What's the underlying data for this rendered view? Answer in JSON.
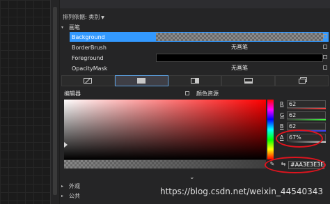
{
  "panel": {
    "sort_label": "排列依据: 类别",
    "section_brush": "画笔",
    "section_appearance": "外观",
    "section_common": "公共"
  },
  "properties": [
    {
      "name": "Background",
      "value": "",
      "kind": "checker",
      "selected": true
    },
    {
      "name": "BorderBrush",
      "value": "无画笔",
      "kind": "text"
    },
    {
      "name": "Foreground",
      "value": "",
      "kind": "black"
    },
    {
      "name": "OpacityMask",
      "value": "无画笔",
      "kind": "text"
    }
  ],
  "brush_tabs": [
    "no-brush-icon",
    "solid-color-brush-icon",
    "gradient-brush-icon",
    "image-brush-icon",
    "resource-brush-icon"
  ],
  "editor": {
    "editor_label": "编辑器",
    "resources_label": "颜色资源",
    "hue_color": "#ff0000",
    "channels": {
      "r_label": "R",
      "r_value": "62",
      "g_label": "G",
      "g_value": "62",
      "b_label": "B",
      "b_value": "62",
      "a_label": "A",
      "a_value": "67%"
    },
    "hex_value": "#AA3E3E3E"
  },
  "watermark": "https://blog.csdn.net/weixin_44540343",
  "colors": {
    "accent": "#3399ff",
    "highlight_oval": "#e0141e"
  }
}
